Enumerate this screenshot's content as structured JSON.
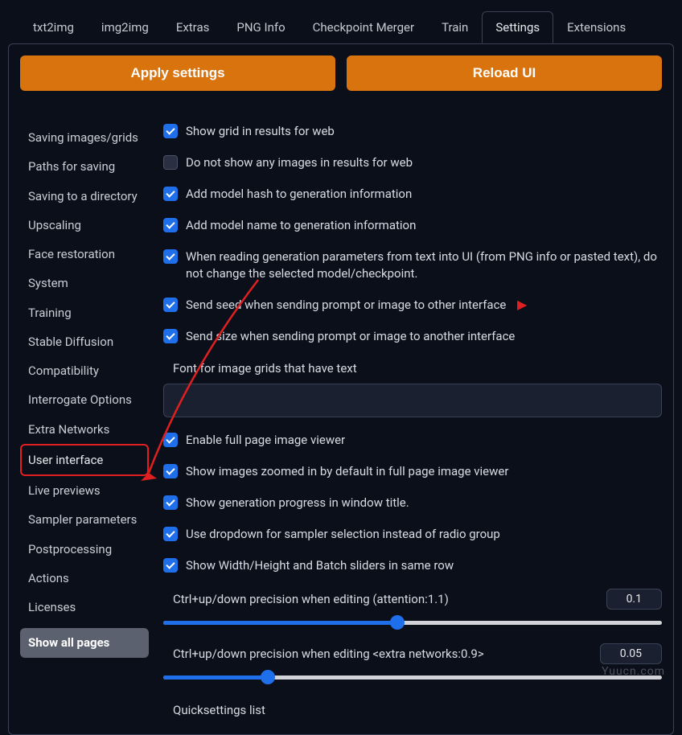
{
  "tabs": {
    "txt2img": "txt2img",
    "img2img": "img2img",
    "extras": "Extras",
    "pnginfo": "PNG Info",
    "checkpoint_merger": "Checkpoint Merger",
    "train": "Train",
    "settings": "Settings",
    "extensions": "Extensions"
  },
  "buttons": {
    "apply": "Apply settings",
    "reload": "Reload UI"
  },
  "sidebar": {
    "saving_images": "Saving images/grids",
    "paths": "Paths for saving",
    "saving_dir": "Saving to a directory",
    "upscaling": "Upscaling",
    "face": "Face restoration",
    "system": "System",
    "training": "Training",
    "stable_diffusion": "Stable Diffusion",
    "compatibility": "Compatibility",
    "interrogate": "Interrogate Options",
    "extra_networks": "Extra Networks",
    "user_interface": "User interface",
    "live_previews": "Live previews",
    "sampler": "Sampler parameters",
    "postprocessing": "Postprocessing",
    "actions": "Actions",
    "licenses": "Licenses",
    "show_all": "Show all pages"
  },
  "checks": {
    "show_grid": "Show grid in results for web",
    "no_images": "Do not show any images in results for web",
    "add_hash": "Add model hash to generation information",
    "add_name": "Add model name to generation information",
    "read_params": "When reading generation parameters from text into UI (from PNG info or pasted text), do not change the selected model/checkpoint.",
    "send_seed": "Send seed when sending prompt or image to other interface",
    "send_size": "Send size when sending prompt or image to another interface",
    "enable_viewer": "Enable full page image viewer",
    "zoom_default": "Show images zoomed in by default in full page image viewer",
    "gen_progress": "Show generation progress in window title.",
    "dropdown_sampler": "Use dropdown for sampler selection instead of radio group",
    "wh_sliders": "Show Width/Height and Batch sliders in same row"
  },
  "labels": {
    "font_grids": "Font for image grids that have text",
    "precision_attention": "Ctrl+up/down precision when editing (attention:1.1)",
    "precision_extra": "Ctrl+up/down precision when editing <extra networks:0.9>",
    "quicksettings": "Quicksettings list"
  },
  "values": {
    "precision_attention": "0.1",
    "precision_extra": "0.05"
  },
  "sliders": {
    "attention_pct": 47,
    "extra_pct": 21
  },
  "watermark": "Yuucn.com"
}
